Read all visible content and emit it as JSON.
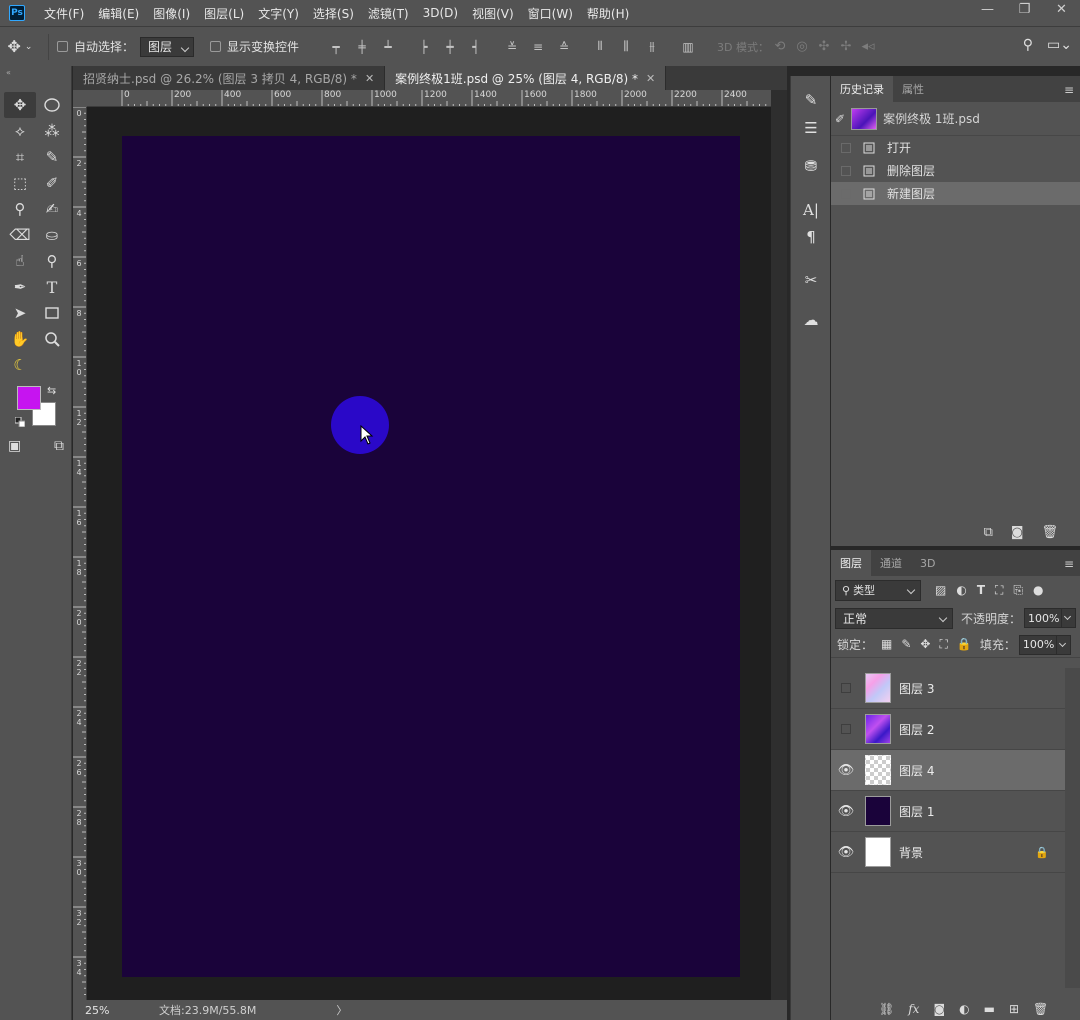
{
  "app": {
    "logo_text": "Ps"
  },
  "menu": [
    "文件(F)",
    "编辑(E)",
    "图像(I)",
    "图层(L)",
    "文字(Y)",
    "选择(S)",
    "滤镜(T)",
    "3D(D)",
    "视图(V)",
    "窗口(W)",
    "帮助(H)"
  ],
  "window_controls": {
    "minimize": "—",
    "restore": "❐",
    "close": "✕"
  },
  "options_bar": {
    "auto_select_label": "自动选择：",
    "auto_select_value": "图层",
    "show_transform_label": "显示变换控件",
    "mode_3d_label": "3D 模式："
  },
  "tools": [
    "move-tool",
    "marquee-tool",
    "lasso-tool",
    "magic-wand-tool",
    "crop-tool",
    "eyedropper-tool",
    "healing-brush-tool",
    "brush-tool",
    "clone-stamp-tool",
    "history-brush-tool",
    "eraser-tool",
    "paint-bucket-tool",
    "smudge-tool",
    "dodge-tool",
    "pen-tool",
    "type-tool",
    "path-selection-tool",
    "rectangle-tool",
    "hand-tool",
    "zoom-tool"
  ],
  "colors": {
    "foreground": "#c614f0",
    "background": "#ffffff",
    "canvas_bg": "#1a033a",
    "brush_circle": "#2a08c8"
  },
  "tabs": [
    {
      "label": "招贤纳士.psd @ 26.2% (图层 3 拷贝 4, RGB/8) *",
      "close": "✕"
    },
    {
      "label": "案例终极1班.psd @ 25% (图层 4, RGB/8) *",
      "close": "✕"
    }
  ],
  "ruler": {
    "top_labels": [
      "0",
      "200",
      "400",
      "600",
      "800",
      "1000",
      "1200",
      "1400",
      "1600",
      "1800",
      "2000",
      "2200",
      "2400"
    ],
    "left_labels": [
      "0",
      "2",
      "4",
      "6",
      "8",
      "1\n0",
      "1\n2",
      "1\n4",
      "1\n6",
      "1\n8",
      "2\n0",
      "2\n2",
      "2\n4",
      "2\n6",
      "2\n8",
      "3\n0",
      "3\n2",
      "3\n4"
    ]
  },
  "status": {
    "zoom": "25%",
    "doc_info": "文档:23.9M/55.8M",
    "arrow": "〉"
  },
  "history_panel": {
    "tabs": [
      "历史记录",
      "属性"
    ],
    "snapshot_name": "案例终极 1班.psd",
    "items": [
      "打开",
      "删除图层",
      "新建图层"
    ]
  },
  "layers_panel": {
    "tabs": [
      "图层",
      "通道",
      "3D"
    ],
    "filter_label": "类型",
    "blend_mode": "正常",
    "opacity_label": "不透明度：",
    "opacity_value": "100%",
    "lock_label": "锁定：",
    "fill_label": "填充：",
    "fill_value": "100%",
    "layers": [
      {
        "name": "图层 3",
        "visible": false
      },
      {
        "name": "图层 2",
        "visible": false
      },
      {
        "name": "图层 4",
        "visible": true,
        "selected": true
      },
      {
        "name": "图层 1",
        "visible": true
      },
      {
        "name": "背景",
        "visible": true,
        "locked": true
      }
    ]
  }
}
